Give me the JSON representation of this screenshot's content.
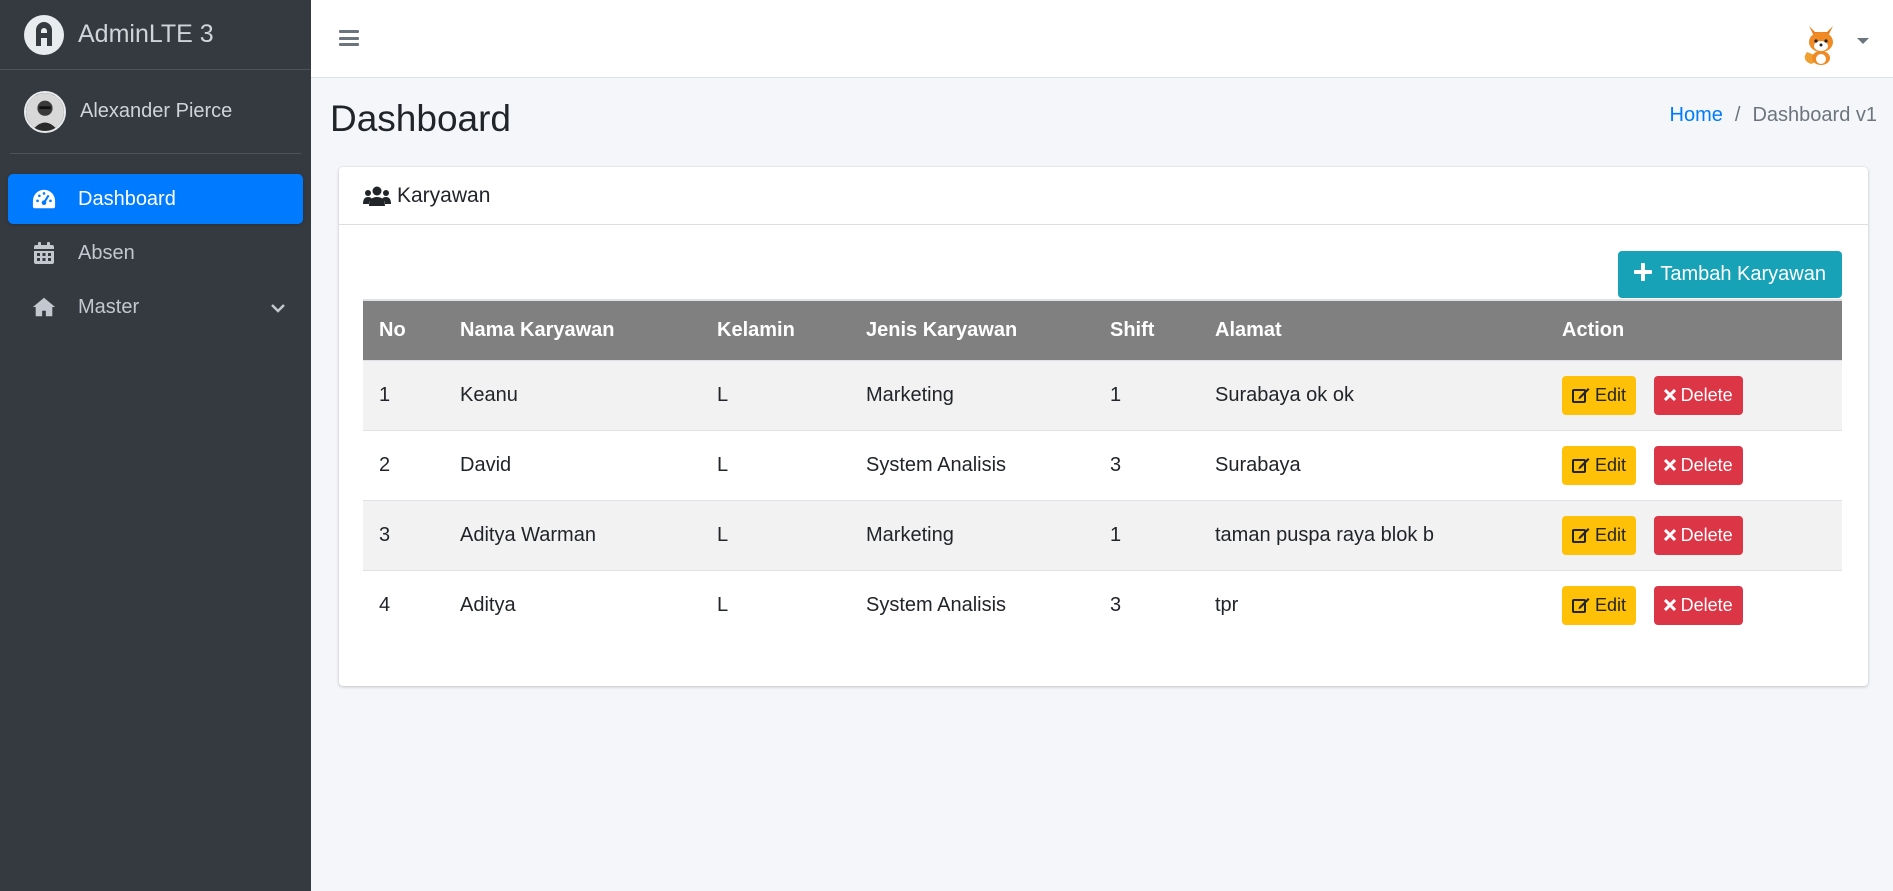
{
  "brand": {
    "name": "AdminLTE 3"
  },
  "user": {
    "name": "Alexander Pierce"
  },
  "sidebar": {
    "items": [
      {
        "label": "Dashboard",
        "icon": "tachometer-icon",
        "active": true
      },
      {
        "label": "Absen",
        "icon": "calendar-icon"
      },
      {
        "label": "Master",
        "icon": "home-icon",
        "expandable": true
      }
    ]
  },
  "header": {
    "title": "Dashboard",
    "breadcrumb": {
      "home": "Home",
      "separator": "/",
      "current": "Dashboard v1"
    }
  },
  "card": {
    "title": "Karyawan",
    "icon": "users-icon",
    "add_button": "Tambah Karyawan",
    "columns": [
      "No",
      "Nama Karyawan",
      "Kelamin",
      "Jenis Karyawan",
      "Shift",
      "Alamat",
      "Action"
    ],
    "rows": [
      [
        "1",
        "Keanu",
        "L",
        "Marketing",
        "1",
        "Surabaya ok ok"
      ],
      [
        "2",
        "David",
        "L",
        "System Analisis",
        "3",
        "Surabaya"
      ],
      [
        "3",
        "Aditya Warman",
        "L",
        "Marketing",
        "1",
        "taman puspa raya blok b"
      ],
      [
        "4",
        "Aditya",
        "L",
        "System Analisis",
        "3",
        "tpr"
      ]
    ],
    "edit_label": "Edit",
    "delete_label": "Delete"
  },
  "colors": {
    "primary": "#007bff",
    "info": "#17a2b8",
    "warning": "#ffc107",
    "danger": "#dc3545",
    "sidebar": "#343a40",
    "table_head": "#808080"
  }
}
